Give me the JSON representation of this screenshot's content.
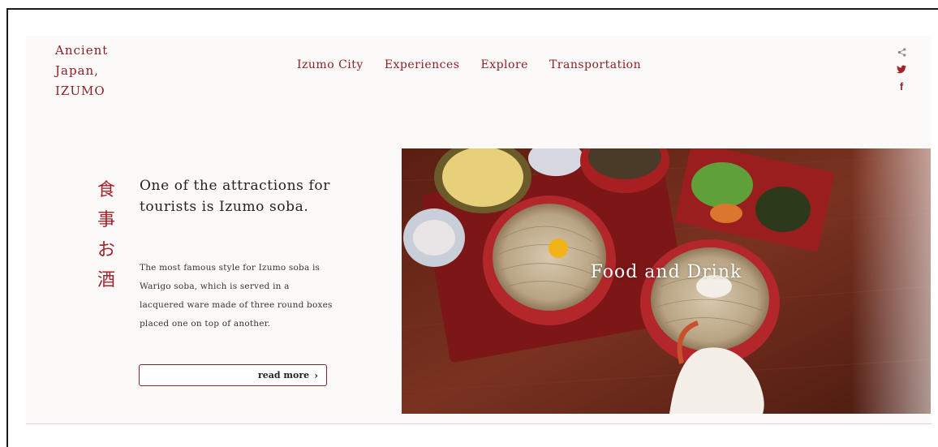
{
  "brand": {
    "line1": "Ancient",
    "line2": "Japan,",
    "line3": "IZUMO"
  },
  "nav": {
    "items": [
      "Izumo City",
      "Experiences",
      "Explore",
      "Transportation"
    ]
  },
  "social": {
    "icons": [
      "share-icon",
      "twitter-icon",
      "facebook-icon"
    ],
    "facebook_glyph": "f"
  },
  "feature": {
    "kanji": [
      "食",
      "事",
      "お",
      "酒"
    ],
    "headline": "One of the attractions for tourists is Izumo soba.",
    "description": "The most famous style for Izumo soba is Warigo soba, which is served in a lacquered ware made of three round boxes placed one on top of another.",
    "read_more": "read more",
    "read_more_chevron": "›",
    "photo_caption": "Food and Drink"
  },
  "colors": {
    "accent": "#8e1f25",
    "page_bg": "#fcfaf9",
    "table_wood": "#6b2a1a",
    "lacquer_red": "#b3262a"
  }
}
